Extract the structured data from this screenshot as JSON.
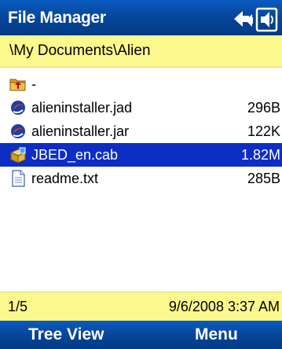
{
  "window": {
    "title": "File Manager",
    "title_bar_icons": [
      "connectivity-icon",
      "speaker-icon"
    ]
  },
  "path_bar": {
    "path": "\\My Documents\\Alien"
  },
  "file_list": {
    "items": [
      {
        "name": "-",
        "size": "",
        "icon": "folder-up-icon",
        "selected": false
      },
      {
        "name": "alieninstaller.jad",
        "size": "296B",
        "icon": "java-app-icon",
        "selected": false
      },
      {
        "name": "alieninstaller.jar",
        "size": "122K",
        "icon": "java-app-icon",
        "selected": false
      },
      {
        "name": "JBED_en.cab",
        "size": "1.82M",
        "icon": "cab-package-icon",
        "selected": true
      },
      {
        "name": "readme.txt",
        "size": "285B",
        "icon": "text-file-icon",
        "selected": false
      }
    ]
  },
  "status_bar": {
    "position": "1/5",
    "datetime": "9/6/2008 3:37 AM"
  },
  "softkeys": {
    "left": "Tree View",
    "right": "Menu"
  },
  "colors": {
    "title_bar": "#06469a",
    "path_bar": "#fbf88d",
    "selection": "#0c2ec4"
  }
}
